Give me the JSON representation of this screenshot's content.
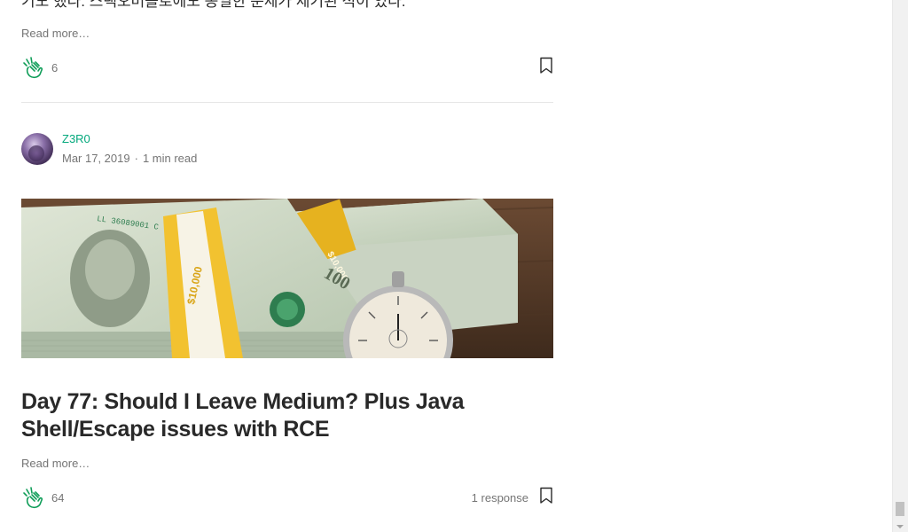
{
  "previous_post": {
    "excerpt_tail": "기도 했다. 스택오버플로에도 동일한 문제가 제기된 적이 있다.",
    "read_more_label": "Read more…",
    "clap_count": "6"
  },
  "post": {
    "author_name": "Z3R0",
    "date": "Mar 17, 2019",
    "read_time": "1 min read",
    "dot": "·",
    "title": "Day 77: Should I Leave Medium? Plus Java Shell/Escape issues with RCE",
    "read_more_label": "Read more…",
    "clap_count": "64",
    "responses_label": "1 response",
    "hero_image_labels": {
      "band_1": "$10,000",
      "band_2": "$10,000",
      "note_value": "100",
      "serial": "LL 36089001 C"
    }
  },
  "colors": {
    "accent_green": "#03a87c",
    "muted_text": "#757575",
    "divider": "#e6e6e6"
  },
  "icons": {
    "clap": "clap-icon",
    "bookmark": "bookmark-icon"
  }
}
